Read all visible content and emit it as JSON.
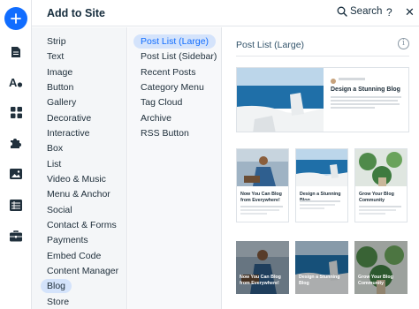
{
  "header": {
    "title": "Add to Site",
    "search_label": "Search",
    "help_label": "?",
    "close_label": "✕"
  },
  "rail": {
    "icons": [
      "add-icon",
      "page-icon",
      "theme-icon",
      "apps-icon",
      "puzzle-icon",
      "media-icon",
      "table-icon",
      "business-icon"
    ]
  },
  "categories": {
    "selected": "Blog",
    "items": [
      {
        "label": "Strip"
      },
      {
        "label": "Text"
      },
      {
        "label": "Image"
      },
      {
        "label": "Button"
      },
      {
        "label": "Gallery"
      },
      {
        "label": "Decorative"
      },
      {
        "label": "Interactive"
      },
      {
        "label": "Box"
      },
      {
        "label": "List"
      },
      {
        "label": "Video & Music"
      },
      {
        "label": "Menu & Anchor"
      },
      {
        "label": "Social"
      },
      {
        "label": "Contact & Forms"
      },
      {
        "label": "Payments"
      },
      {
        "label": "Embed Code"
      },
      {
        "label": "Content Manager"
      },
      {
        "label": "Blog"
      },
      {
        "label": "Store"
      }
    ]
  },
  "subcategories": {
    "selected": "Post List (Large)",
    "items": [
      {
        "label": "Post List (Large)"
      },
      {
        "label": "Post List (Sidebar)"
      },
      {
        "label": "Recent Posts"
      },
      {
        "label": "Category Menu"
      },
      {
        "label": "Tag Cloud"
      },
      {
        "label": "Archive"
      },
      {
        "label": "RSS Button"
      }
    ]
  },
  "panel": {
    "title": "Post List (Large)",
    "info_label": "i",
    "large_card": {
      "title": "Design a Stunning Blog"
    },
    "cards": [
      {
        "title": "Now You Can Blog from Everywhere!",
        "scene": "person"
      },
      {
        "title": "Design a Stunning Blog",
        "scene": "sea"
      },
      {
        "title": "Grow Your Blog Community",
        "scene": "plants"
      }
    ],
    "overlay_cards": [
      {
        "title": "Now You Can Blog from Everywhere!",
        "scene": "person"
      },
      {
        "title": "Design a Stunning Blog",
        "scene": "sea"
      },
      {
        "title": "Grow Your Blog Community",
        "scene": "plants"
      }
    ]
  },
  "colors": {
    "accent": "#116dff",
    "selected_bg": "#d4e3fb",
    "sea": "#1f6fa8",
    "sky": "#bcd6ea",
    "building": "#f1f3f4"
  }
}
